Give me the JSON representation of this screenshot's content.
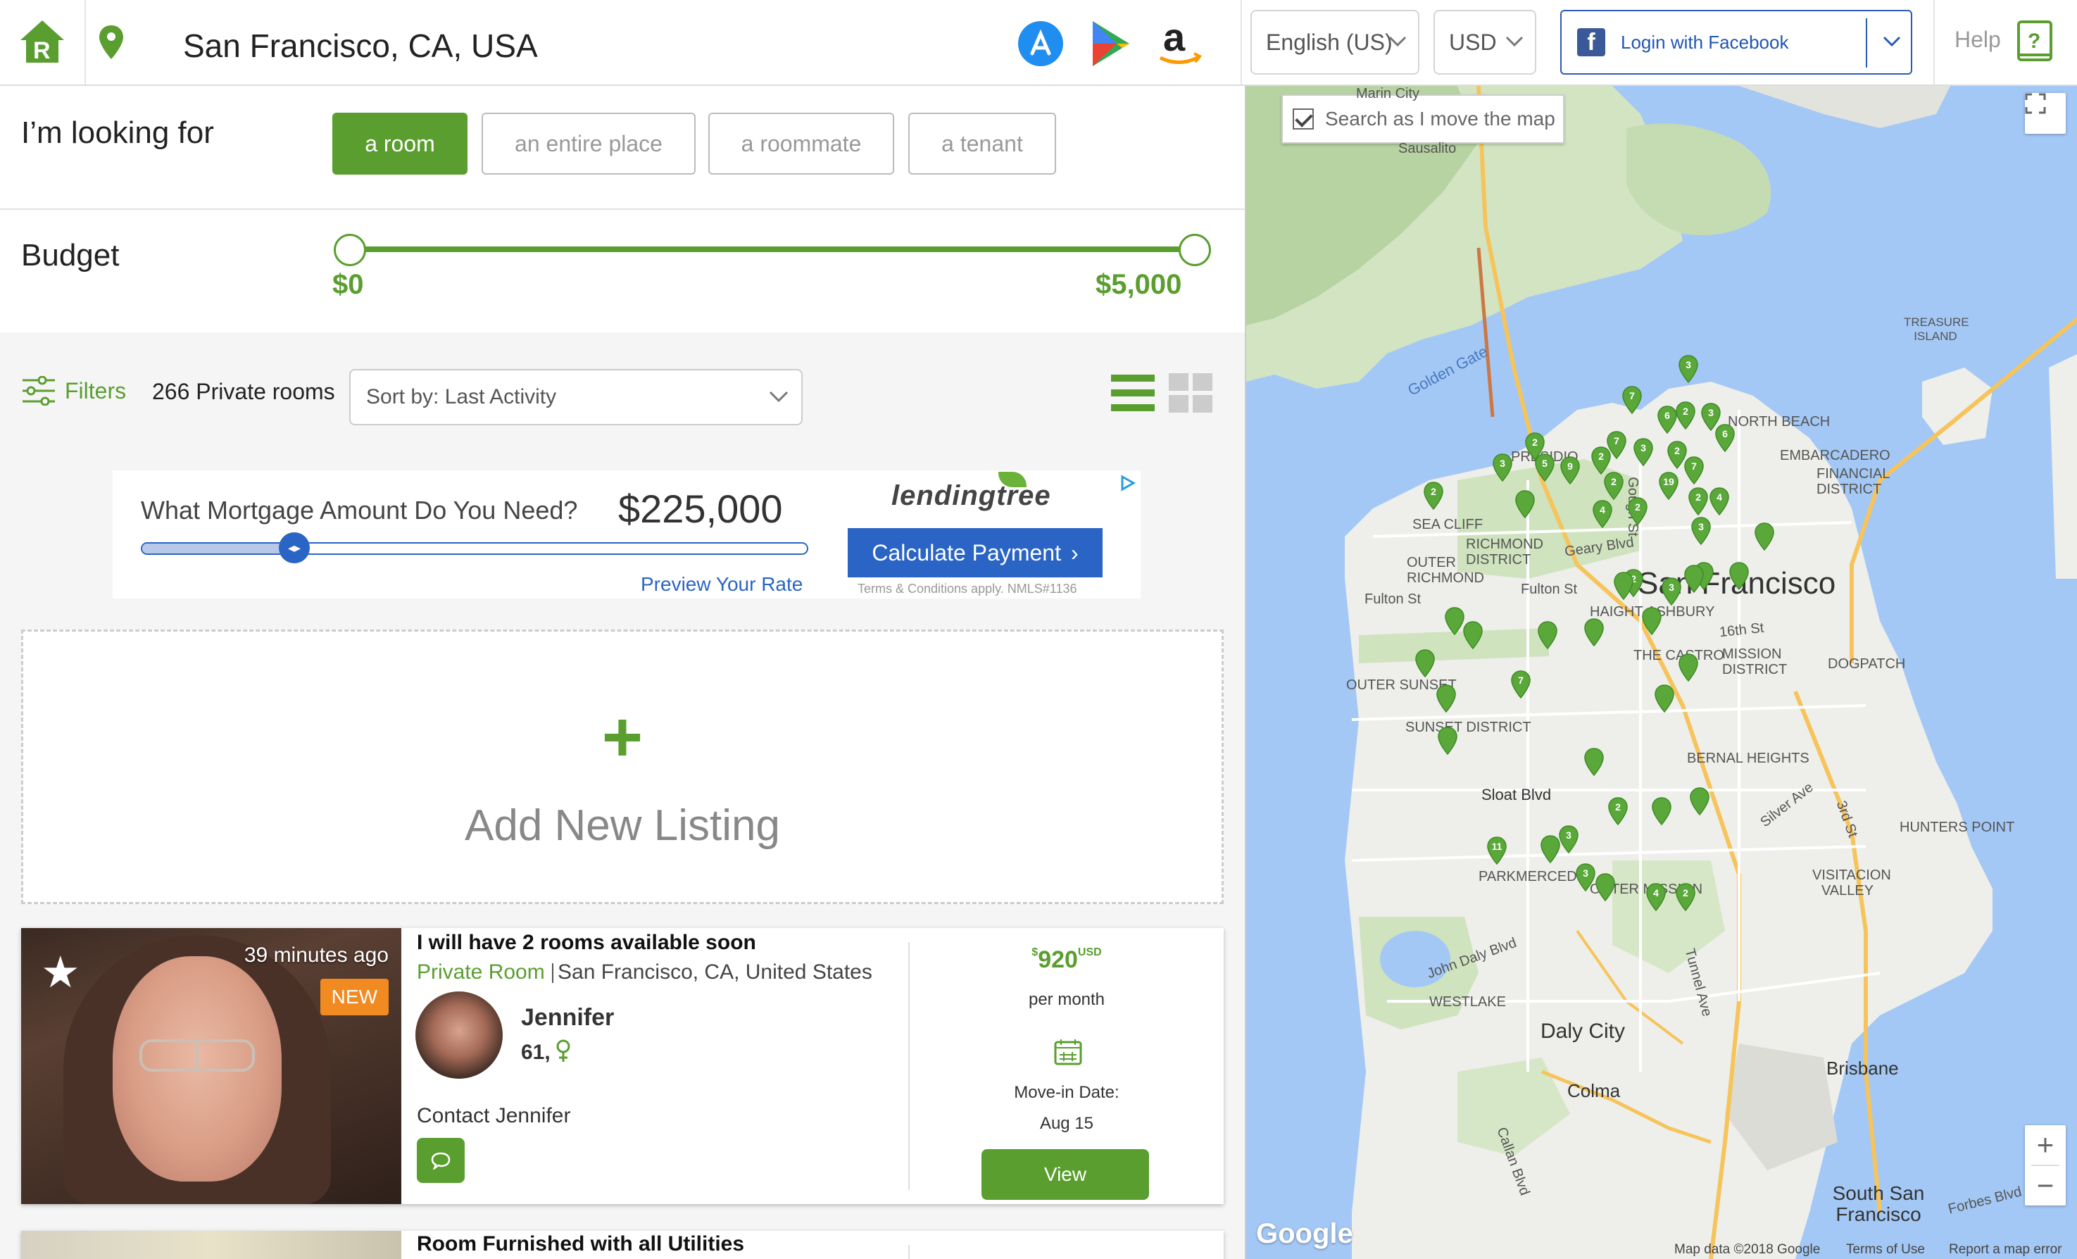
{
  "header": {
    "location": "San Francisco, CA, USA",
    "language": "English (US)",
    "currency": "USD",
    "facebook_login": "Login with Facebook",
    "help": "Help"
  },
  "search": {
    "looking_for_label": "I’m looking for",
    "types": [
      "a room",
      "an entire place",
      "a roommate",
      "a tenant"
    ],
    "active_type": "a room"
  },
  "budget": {
    "label": "Budget",
    "min": "$0",
    "max": "$5,000",
    "range_fraction": [
      0,
      1
    ]
  },
  "results": {
    "filters_label": "Filters",
    "count_label": "266 Private rooms",
    "sort_label": "Sort by: Last Activity"
  },
  "ad": {
    "question": "What Mortgage Amount Do You Need?",
    "amount": "$225,000",
    "preview": "Preview Your Rate",
    "brand": "lendingtree",
    "cta": "Calculate Payment",
    "terms": "Terms & Conditions apply. NMLS#1136",
    "slider_fraction": 0.23
  },
  "add_listing": {
    "label": "Add New Listing",
    "plus": "+"
  },
  "listings": [
    {
      "time_ago": "39 minutes ago",
      "badge": "NEW",
      "title": "I will have 2 rooms available soon",
      "type": "Private Room",
      "location": "San Francisco, CA, United States",
      "user_name": "Jennifer",
      "user_age": "61,",
      "contact": "Contact Jennifer",
      "price": "920",
      "price_prefix": "$",
      "price_currency": "USD",
      "per_month": "per month",
      "move_in_label": "Move-in Date:",
      "move_in_date": "Aug 15",
      "view_label": "View"
    },
    {
      "title": "Room Furnished with all Utilities"
    }
  ],
  "map": {
    "search_as_move": "Search as I move the map",
    "google": "Google",
    "map_data": "Map data ©2018 Google",
    "terms": "Terms of Use",
    "report": "Report a map error",
    "zoom_in": "+",
    "zoom_out": "−",
    "labels": {
      "san_francisco": "San Francisco",
      "daly_city": "Daly City",
      "brisbane": "Brisbane",
      "colma": "Colma",
      "south_sf": "South San Francisco",
      "sausalito": "Sausalito",
      "marin": "Marin City",
      "treasure": "TREASURE ISLAND",
      "golden_gate": "Golden Gate",
      "presidio": "PRESIDIO",
      "north_beach": "NORTH BEACH",
      "embarcadero": "EMBARCADERO",
      "financial": "FINANCIAL DISTRICT",
      "sea_cliff": "SEA CLIFF",
      "richmond": "RICHMOND DISTRICT",
      "outer_richmond": "OUTER RICHMOND",
      "haight": "HAIGHT-ASHBURY",
      "castro": "THE CASTRO",
      "mission": "MISSION DISTRICT",
      "dogpatch": "DOGPATCH",
      "outer_sunset": "OUTER SUNSET",
      "sunset": "SUNSET DISTRICT",
      "bernal": "BERNAL HEIGHTS",
      "hunters": "HUNTERS POINT",
      "visitacion": "VISITACION VALLEY",
      "parkmerced": "PARKMERCED",
      "outer_mission": "OUTER MISSION",
      "westlake": "WESTLAKE",
      "sloat": "Sloat Blvd",
      "fulton": "Fulton St",
      "fulton2": "Fulton St",
      "geary": "Geary Blvd",
      "16th": "16th St",
      "silver": "Silver Ave",
      "3rd": "3rd St",
      "john_daly": "John Daly Blvd",
      "tunnel": "Tunnel Ave",
      "callan": "Callan Blvd",
      "forbes": "Forbes Blvd",
      "gough": "Gough St"
    },
    "markers": [
      "3",
      "7",
      "6",
      "2",
      "3",
      "6",
      "2",
      "7",
      "3",
      "2",
      "2",
      "7",
      "3",
      "5",
      "9",
      "2",
      "19",
      "2",
      "2",
      "4",
      "2",
      "4",
      "3",
      "",
      "2",
      "3",
      "",
      "",
      "7",
      "",
      "",
      "",
      "",
      "",
      "",
      "",
      "",
      "2",
      "",
      "",
      "3",
      "",
      "11",
      "3",
      "",
      "4",
      "2",
      "",
      "",
      "",
      "",
      "",
      ""
    ]
  }
}
